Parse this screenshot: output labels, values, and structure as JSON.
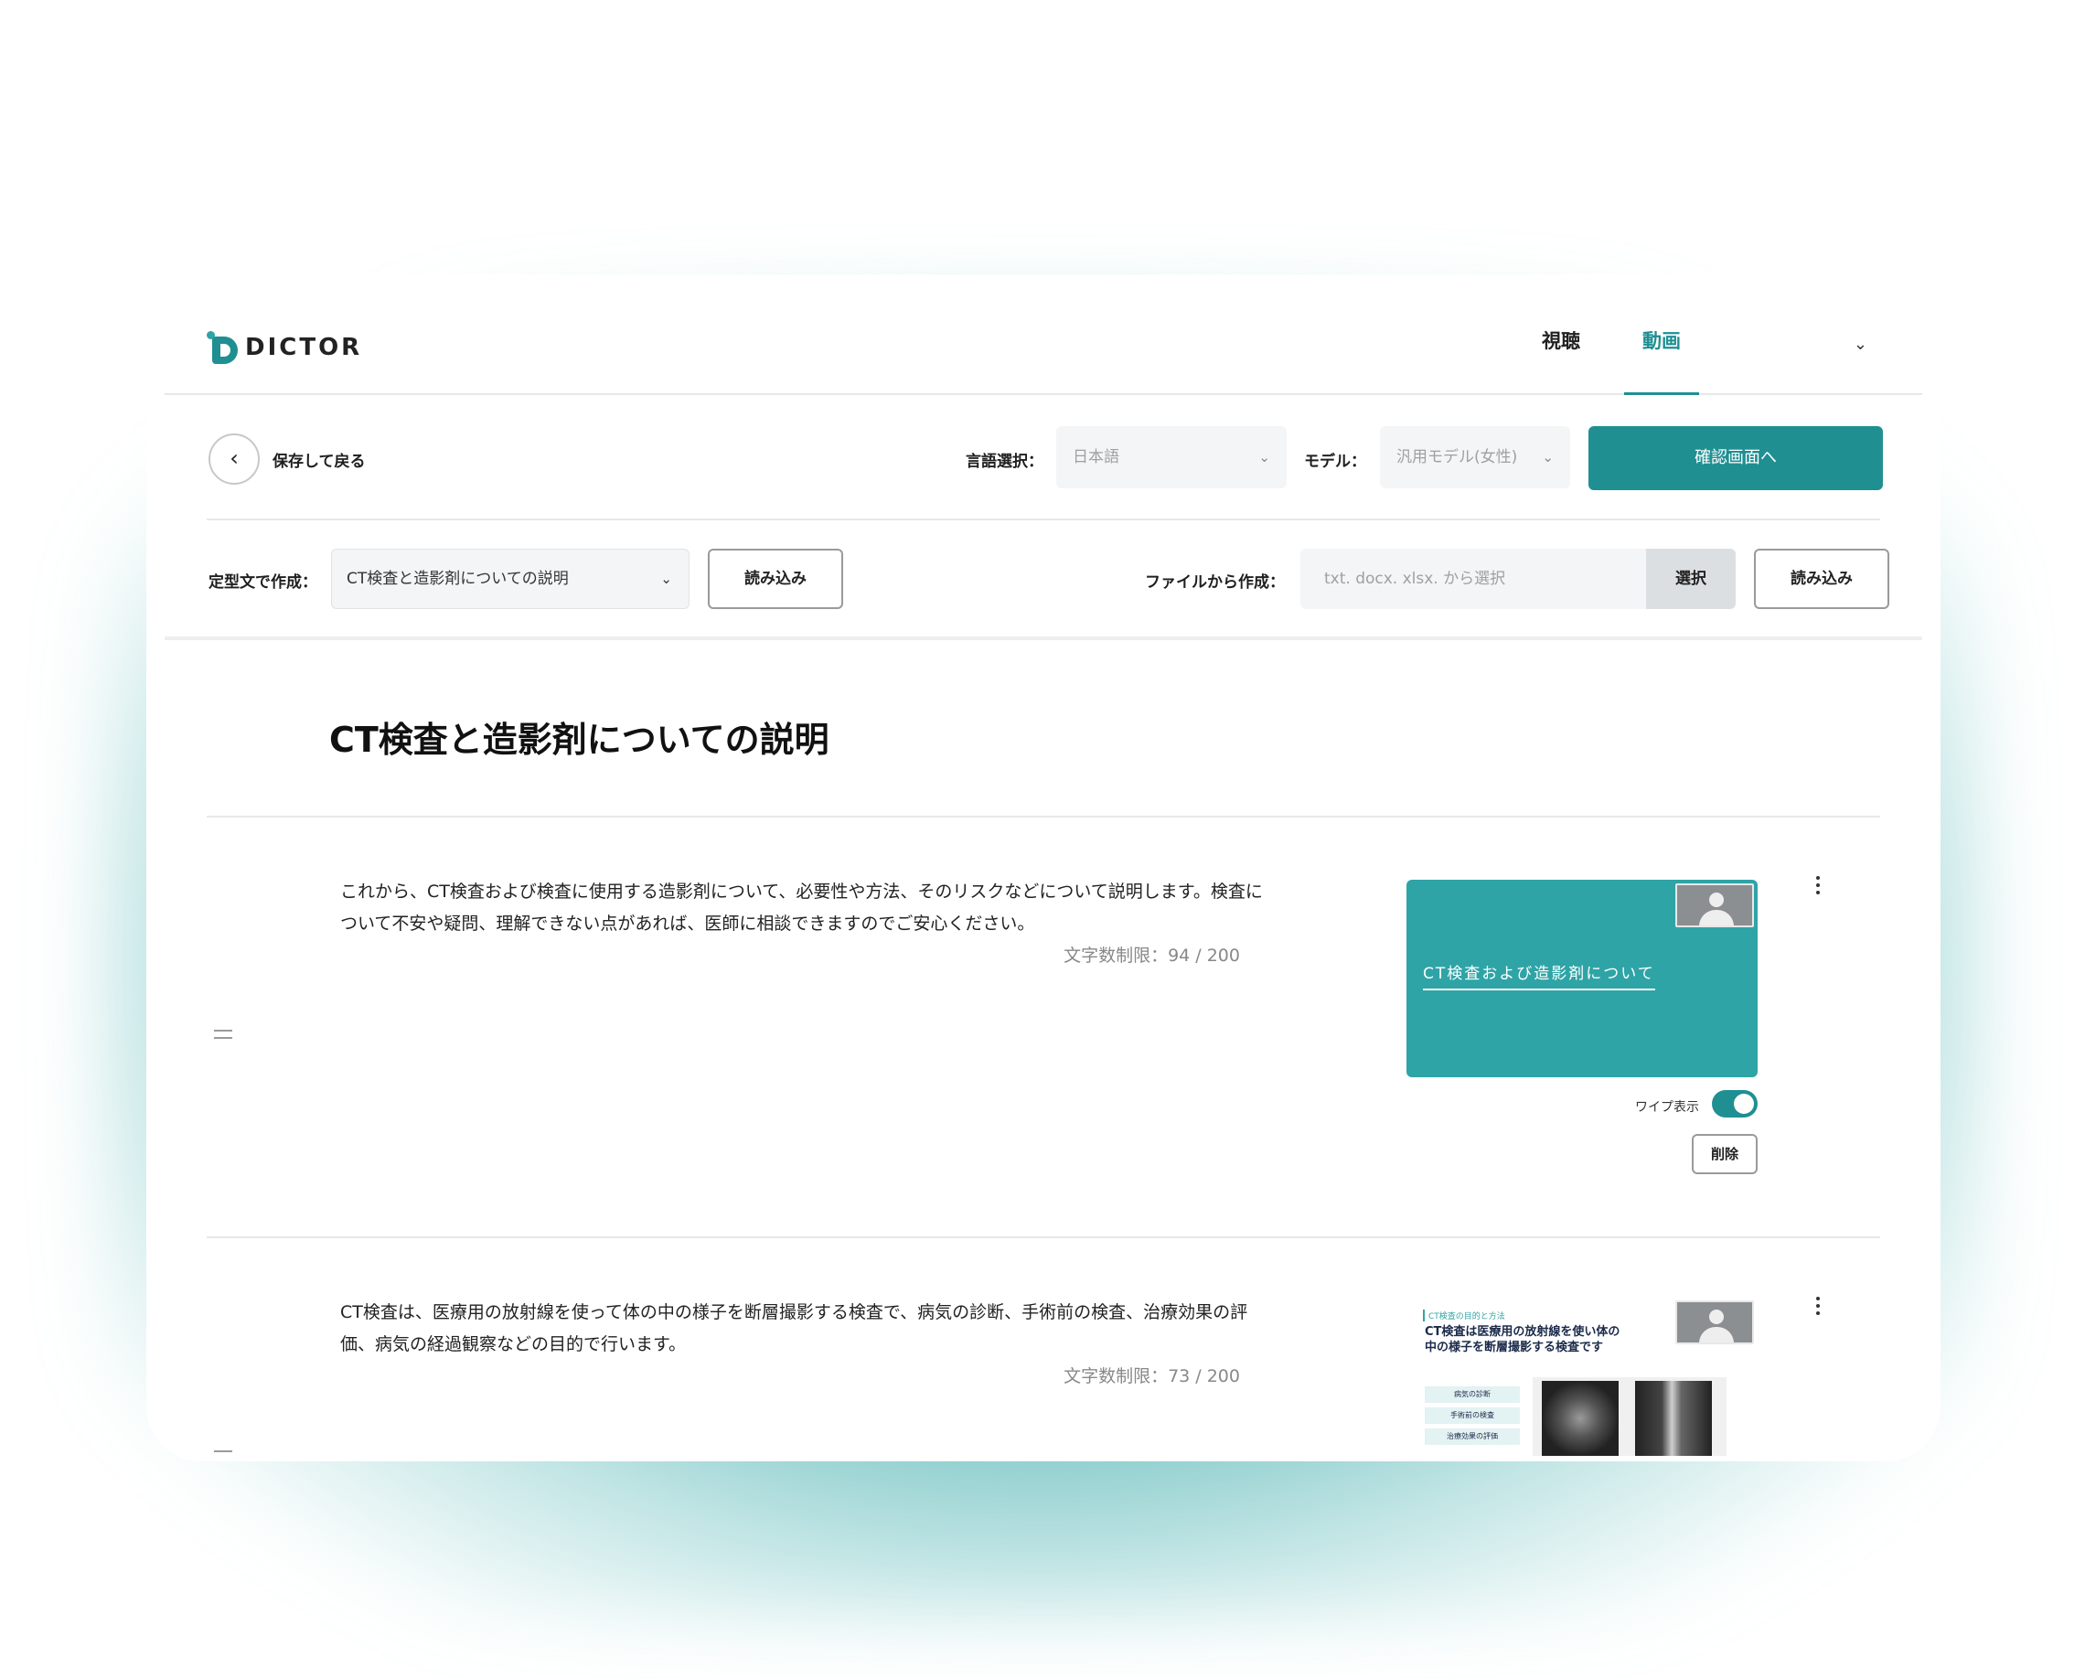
{
  "app": {
    "brand": "DICTOR",
    "accent_color": "#1f8f92",
    "nav_tabs": [
      {
        "label": "視聴",
        "active": false
      },
      {
        "label": "動画",
        "active": true
      }
    ],
    "nav_menu_icon": "chevron-down-icon"
  },
  "toolbar": {
    "back_label": "保存して戻る",
    "back_icon": "chevron-left-icon",
    "lang_label": "言語選択：",
    "lang_value": "日本語",
    "model_label": "モデル：",
    "model_value": "汎用モデル(女性)",
    "confirm_label": "確認画面へ"
  },
  "create": {
    "template_label": "定型文で作成：",
    "template_value": "CT検査と造影剤についての説明",
    "template_load": "読み込み",
    "file_label": "ファイルから作成：",
    "file_placeholder": "txt. docx. xlsx. から選択",
    "file_select": "選択",
    "file_load": "読み込み"
  },
  "document": {
    "title": "CT検査と造影剤についての説明",
    "sections": [
      {
        "text": "これから、CT検査および検査に使用する造影剤について、必要性や方法、そのリスクなどについて説明します。検査について不安や疑問、理解できない点があれば、医師に相談できますのでご安心ください。",
        "char_count": "文字数制限：94 / 200",
        "slide_title": "CT検査および造影剤について",
        "wipe_label": "ワイプ表示",
        "wipe_on": true,
        "delete_label": "削除"
      },
      {
        "text": "CT検査は、医療用の放射線を使って体の中の様子を断層撮影する検査で、病気の診断、手術前の検査、治療効果の評価、病気の経過観察などの目的で行います。",
        "char_count": "文字数制限：73 / 200",
        "slide_kicker": "CT検査の目的と方法",
        "slide_heading": "CT検査は医療用の放射線を使い体の中の様子を断層撮影する検査です",
        "slide_pills": [
          "病気の診断",
          "手術前の検査",
          "治療効果の評価"
        ]
      }
    ]
  }
}
